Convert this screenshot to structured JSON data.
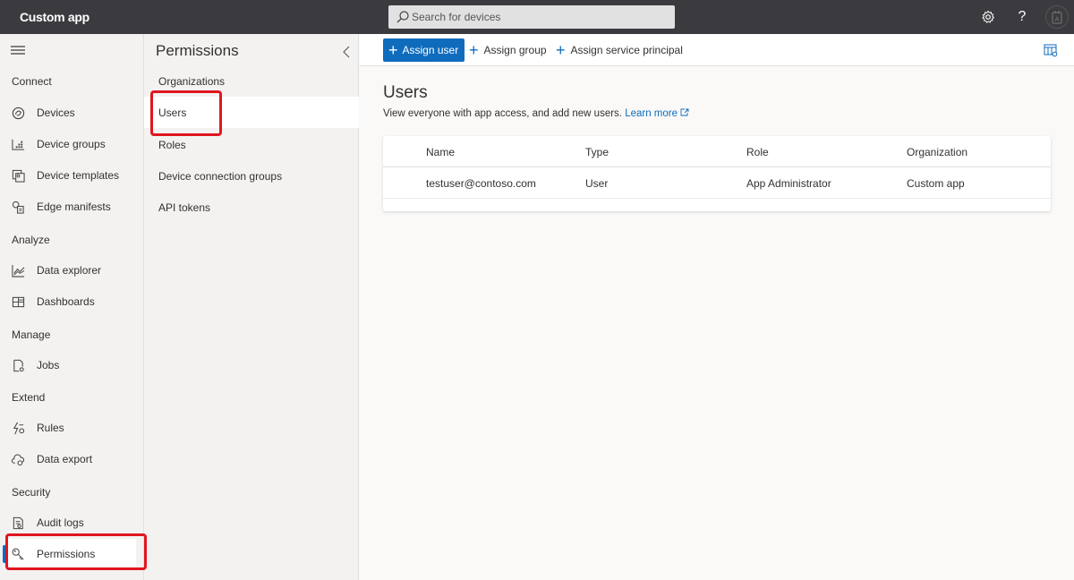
{
  "header": {
    "app_title": "Custom app",
    "search_placeholder": "Search for devices",
    "icons": [
      "search-icon",
      "settings-icon",
      "help-icon",
      "avatar-icon"
    ],
    "help_glyph": "?"
  },
  "leftnav": {
    "sections": [
      {
        "label": "Connect",
        "items": [
          {
            "label": "Devices",
            "icon": "devices-icon"
          },
          {
            "label": "Device groups",
            "icon": "device-groups-icon"
          },
          {
            "label": "Device templates",
            "icon": "device-templates-icon"
          },
          {
            "label": "Edge manifests",
            "icon": "edge-manifests-icon"
          }
        ]
      },
      {
        "label": "Analyze",
        "items": [
          {
            "label": "Data explorer",
            "icon": "data-explorer-icon"
          },
          {
            "label": "Dashboards",
            "icon": "dashboards-icon"
          }
        ]
      },
      {
        "label": "Manage",
        "items": [
          {
            "label": "Jobs",
            "icon": "jobs-icon"
          }
        ]
      },
      {
        "label": "Extend",
        "items": [
          {
            "label": "Rules",
            "icon": "rules-icon"
          },
          {
            "label": "Data export",
            "icon": "data-export-icon"
          }
        ]
      },
      {
        "label": "Security",
        "items": [
          {
            "label": "Audit logs",
            "icon": "audit-logs-icon"
          },
          {
            "label": "Permissions",
            "icon": "key-icon",
            "active": true
          }
        ]
      }
    ]
  },
  "subnav": {
    "title": "Permissions",
    "items": [
      {
        "label": "Organizations"
      },
      {
        "label": "Users",
        "active": true
      },
      {
        "label": "Roles"
      },
      {
        "label": "Device connection groups"
      },
      {
        "label": "API tokens"
      }
    ]
  },
  "toolbar": {
    "assign_user": "Assign user",
    "assign_group": "Assign group",
    "assign_service_principal": "Assign service principal"
  },
  "main": {
    "title": "Users",
    "description": "View everyone with app access, and add new users.",
    "learn_more": "Learn more",
    "table": {
      "columns": [
        "Name",
        "Type",
        "Role",
        "Organization"
      ],
      "rows": [
        [
          "testuser@contoso.com",
          "User",
          "App Administrator",
          "Custom app"
        ]
      ]
    }
  },
  "colors": {
    "accent": "#0f6cbd",
    "header_bg": "#3b3a3f",
    "highlight": "#e0161f"
  }
}
